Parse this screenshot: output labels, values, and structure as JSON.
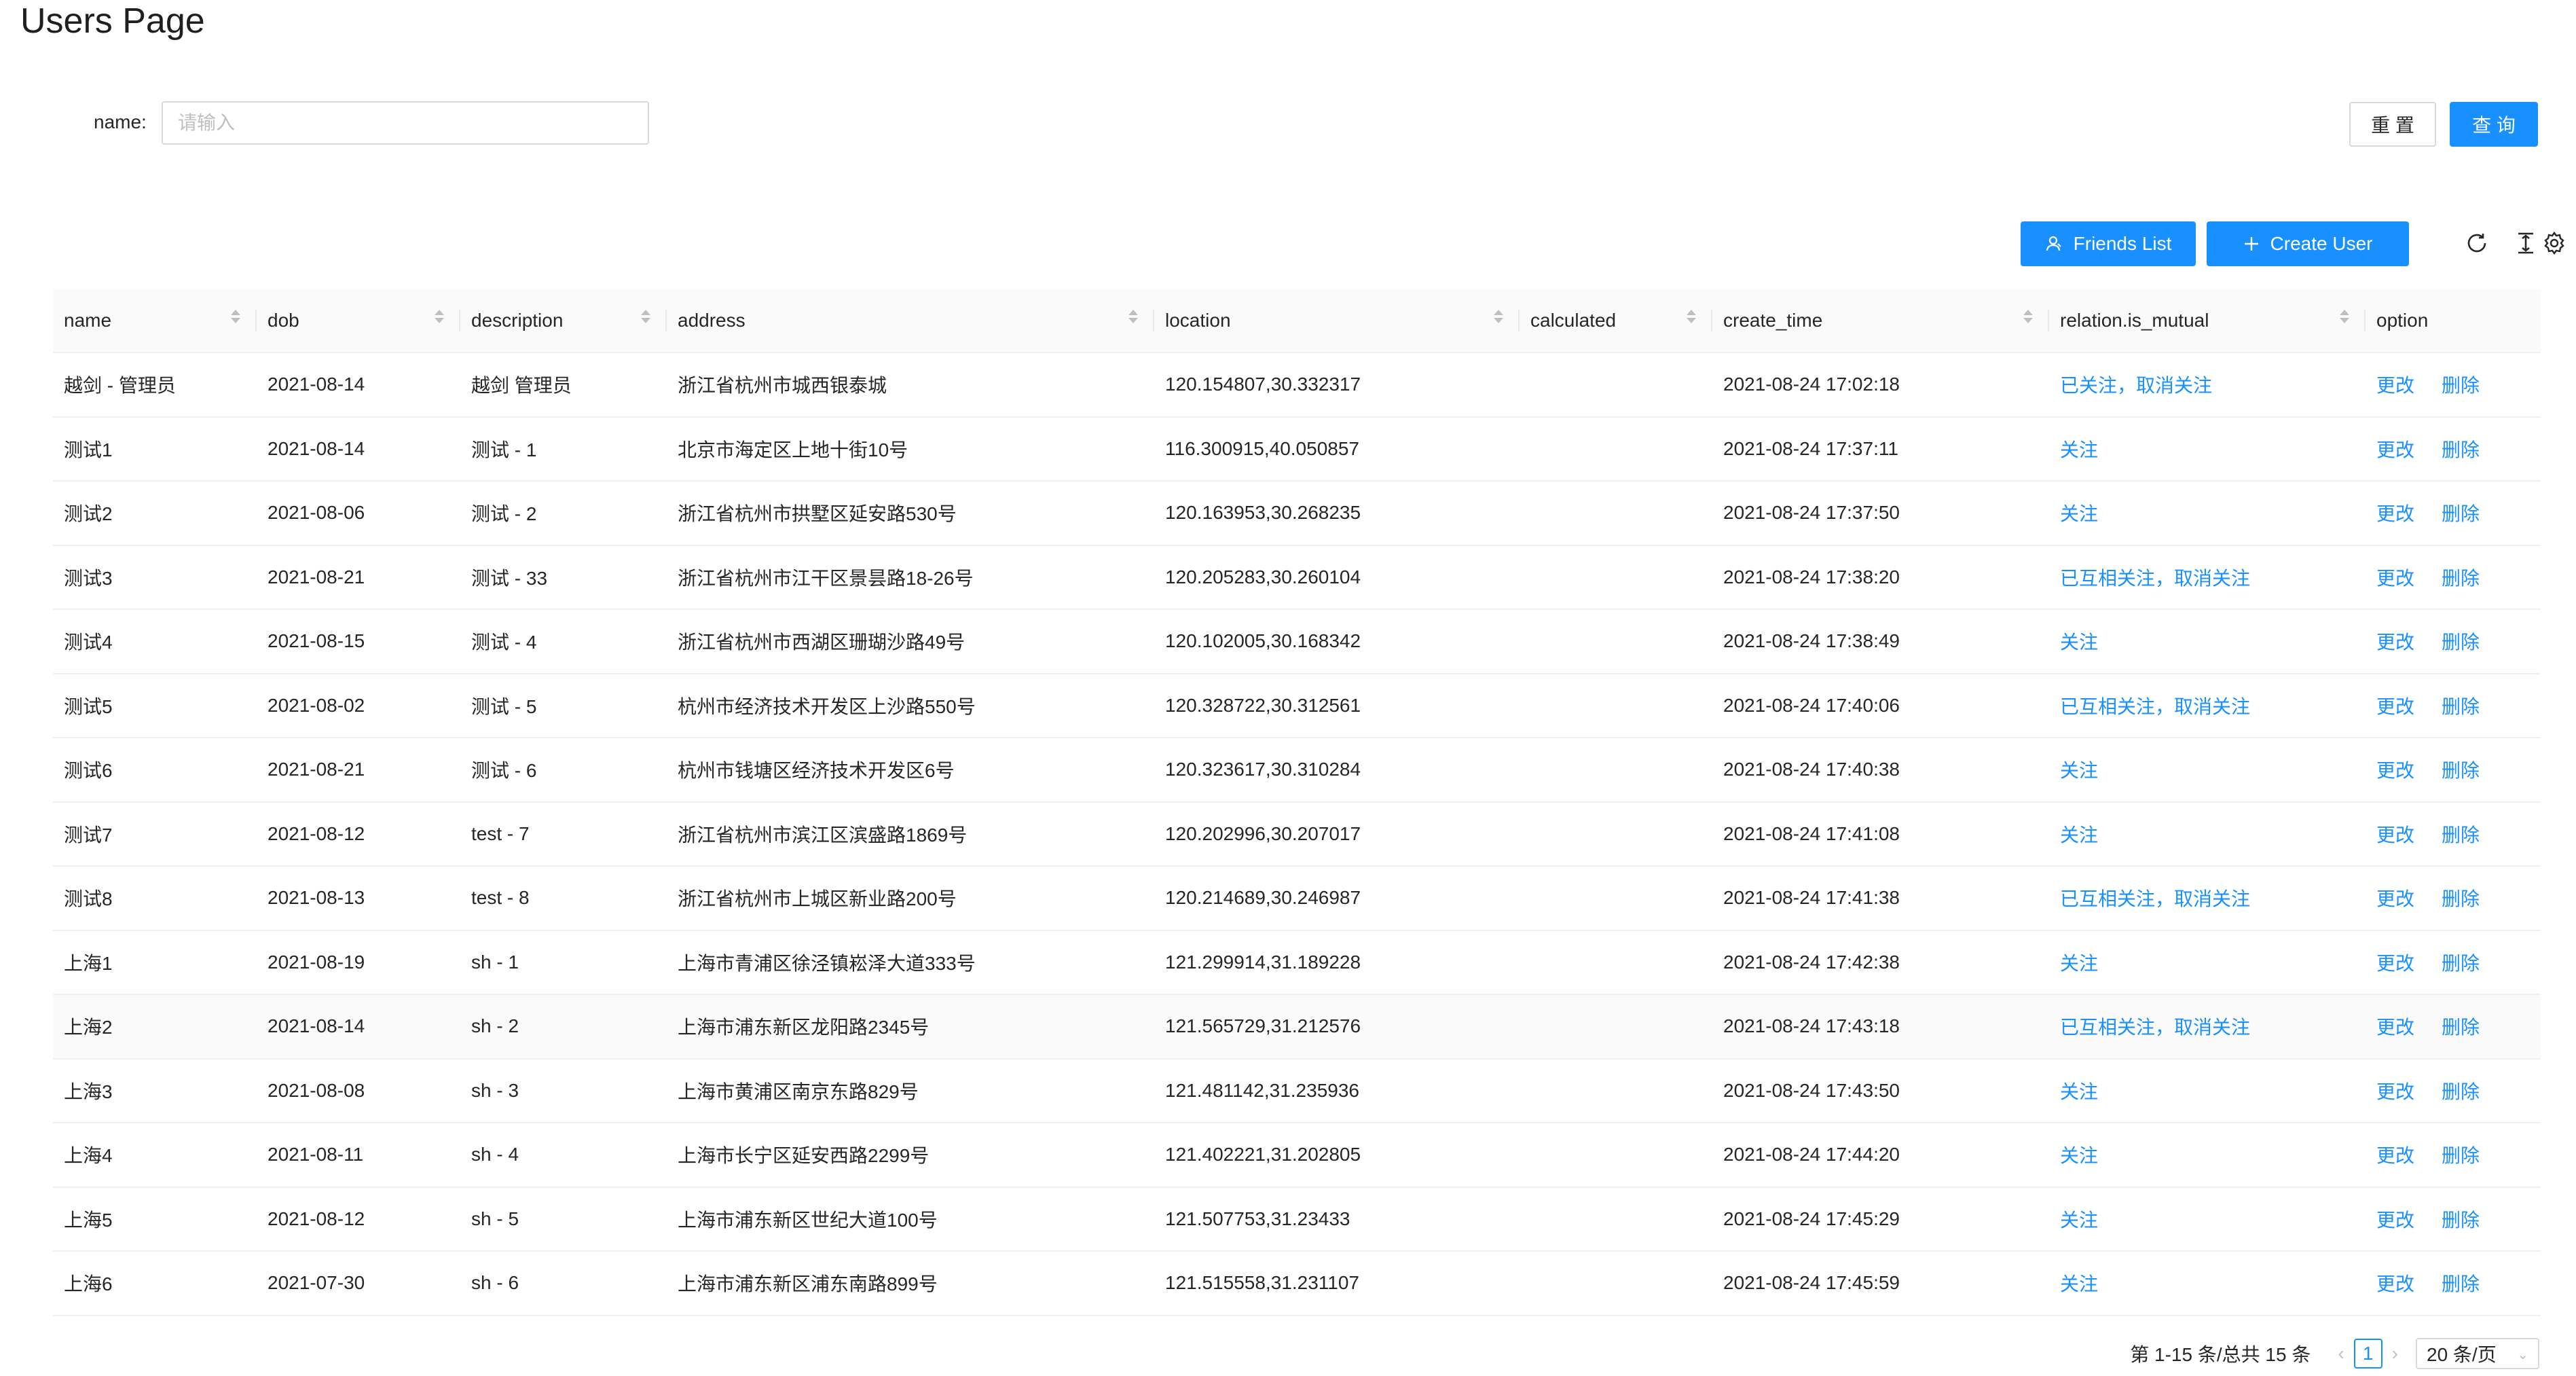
{
  "page": {
    "title": "Users Page"
  },
  "search": {
    "label": "name:",
    "placeholder": "请输入",
    "value": "",
    "reset_label": "重 置",
    "query_label": "查 询"
  },
  "toolbar": {
    "friends_label": "Friends List",
    "create_label": "Create User",
    "icons": [
      "user-icon",
      "plus-icon",
      "reload-icon",
      "column-height-icon",
      "settings-icon"
    ]
  },
  "colors": {
    "primary": "#1890ff",
    "header_bg": "#fafafa",
    "border": "#f0f0f0"
  },
  "table": {
    "columns": [
      "name",
      "dob",
      "description",
      "address",
      "location",
      "calculated",
      "create_time",
      "relation.is_mutual",
      "option"
    ],
    "option_labels": {
      "edit": "更改",
      "delete": "删除"
    },
    "rows": [
      {
        "name": "越剑 - 管理员",
        "dob": "2021-08-14",
        "description": "越剑 管理员",
        "address": "浙江省杭州市城西银泰城",
        "location": "120.154807,30.332317",
        "calculated": "",
        "create_time": "2021-08-24 17:02:18",
        "relation": "已关注，取消关注"
      },
      {
        "name": "测试1",
        "dob": "2021-08-14",
        "description": "测试 - 1",
        "address": "北京市海定区上地十街10号",
        "location": "116.300915,40.050857",
        "calculated": "",
        "create_time": "2021-08-24 17:37:11",
        "relation": "关注"
      },
      {
        "name": "测试2",
        "dob": "2021-08-06",
        "description": "测试 - 2",
        "address": "浙江省杭州市拱墅区延安路530号",
        "location": "120.163953,30.268235",
        "calculated": "",
        "create_time": "2021-08-24 17:37:50",
        "relation": "关注"
      },
      {
        "name": "测试3",
        "dob": "2021-08-21",
        "description": "测试 - 33",
        "address": "浙江省杭州市江干区景昙路18-26号",
        "location": "120.205283,30.260104",
        "calculated": "",
        "create_time": "2021-08-24 17:38:20",
        "relation": "已互相关注，取消关注"
      },
      {
        "name": "测试4",
        "dob": "2021-08-15",
        "description": "测试 - 4",
        "address": "浙江省杭州市西湖区珊瑚沙路49号",
        "location": "120.102005,30.168342",
        "calculated": "",
        "create_time": "2021-08-24 17:38:49",
        "relation": "关注"
      },
      {
        "name": "测试5",
        "dob": "2021-08-02",
        "description": "测试 - 5",
        "address": "杭州市经济技术开发区上沙路550号",
        "location": "120.328722,30.312561",
        "calculated": "",
        "create_time": "2021-08-24 17:40:06",
        "relation": "已互相关注，取消关注"
      },
      {
        "name": "测试6",
        "dob": "2021-08-21",
        "description": "测试 - 6",
        "address": "杭州市钱塘区经济技术开发区6号",
        "location": "120.323617,30.310284",
        "calculated": "",
        "create_time": "2021-08-24 17:40:38",
        "relation": "关注"
      },
      {
        "name": "测试7",
        "dob": "2021-08-12",
        "description": "test - 7",
        "address": "浙江省杭州市滨江区滨盛路1869号",
        "location": "120.202996,30.207017",
        "calculated": "",
        "create_time": "2021-08-24 17:41:08",
        "relation": "关注"
      },
      {
        "name": "测试8",
        "dob": "2021-08-13",
        "description": "test - 8",
        "address": "浙江省杭州市上城区新业路200号",
        "location": "120.214689,30.246987",
        "calculated": "",
        "create_time": "2021-08-24 17:41:38",
        "relation": "已互相关注，取消关注"
      },
      {
        "name": "上海1",
        "dob": "2021-08-19",
        "description": "sh - 1",
        "address": "上海市青浦区徐泾镇崧泽大道333号",
        "location": "121.299914,31.189228",
        "calculated": "",
        "create_time": "2021-08-24 17:42:38",
        "relation": "关注"
      },
      {
        "name": "上海2",
        "dob": "2021-08-14",
        "description": "sh - 2",
        "address": "上海市浦东新区龙阳路2345号",
        "location": "121.565729,31.212576",
        "calculated": "",
        "create_time": "2021-08-24 17:43:18",
        "relation": "已互相关注，取消关注"
      },
      {
        "name": "上海3",
        "dob": "2021-08-08",
        "description": "sh - 3",
        "address": "上海市黄浦区南京东路829号",
        "location": "121.481142,31.235936",
        "calculated": "",
        "create_time": "2021-08-24 17:43:50",
        "relation": "关注"
      },
      {
        "name": "上海4",
        "dob": "2021-08-11",
        "description": "sh - 4",
        "address": "上海市长宁区延安西路2299号",
        "location": "121.402221,31.202805",
        "calculated": "",
        "create_time": "2021-08-24 17:44:20",
        "relation": "关注"
      },
      {
        "name": "上海5",
        "dob": "2021-08-12",
        "description": "sh - 5",
        "address": "上海市浦东新区世纪大道100号",
        "location": "121.507753,31.23433",
        "calculated": "",
        "create_time": "2021-08-24 17:45:29",
        "relation": "关注"
      },
      {
        "name": "上海6",
        "dob": "2021-07-30",
        "description": "sh - 6",
        "address": "上海市浦东新区浦东南路899号",
        "location": "121.515558,31.231107",
        "calculated": "",
        "create_time": "2021-08-24 17:45:59",
        "relation": "关注"
      }
    ]
  },
  "pagination": {
    "total_text": "第 1-15 条/总共 15 条",
    "current_page": "1",
    "page_size_label": "20 条/页"
  }
}
